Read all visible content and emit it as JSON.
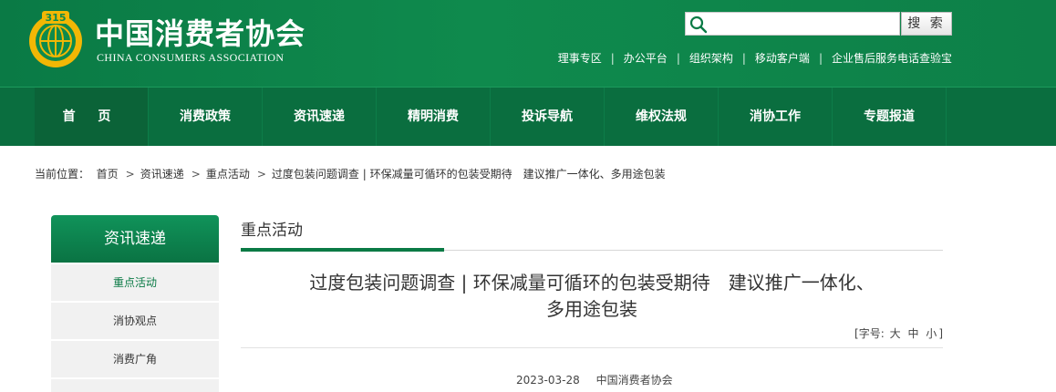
{
  "header": {
    "logo_cn": "中国消费者协会",
    "logo_en": "CHINA CONSUMERS ASSOCIATION",
    "emblem_text": "315",
    "search": {
      "placeholder": "",
      "button_label": "搜 索"
    },
    "top_links": [
      "理事专区",
      "办公平台",
      "组织架构",
      "移动客户端",
      "企业售后服务电话查验宝"
    ]
  },
  "nav": {
    "items": [
      "首 页",
      "消费政策",
      "资讯速递",
      "精明消费",
      "投诉导航",
      "维权法规",
      "消协工作",
      "专题报道"
    ]
  },
  "breadcrumb": {
    "prefix": "当前位置：",
    "items": [
      "首页",
      "资讯速递",
      "重点活动",
      "过度包装问题调查 | 环保减量可循环的包装受期待　建议推广一体化、多用途包装"
    ]
  },
  "sidebar": {
    "title": "资讯速递",
    "items": [
      "重点活动",
      "消协观点",
      "消费广角"
    ]
  },
  "main": {
    "section_label": "重点活动",
    "article_title_line1": "过度包装问题调查 | 环保减量可循环的包装受期待　建议推广一体化、",
    "article_title_line2": "多用途包装",
    "font_size": {
      "prefix": "[字号:",
      "options": [
        "大",
        "中",
        "小"
      ],
      "suffix": "]"
    },
    "date": "2023-03-28",
    "source": "中国消费者协会"
  },
  "colors": {
    "brand_green": "#0a7a45",
    "nav_green": "#0a6e3f"
  }
}
